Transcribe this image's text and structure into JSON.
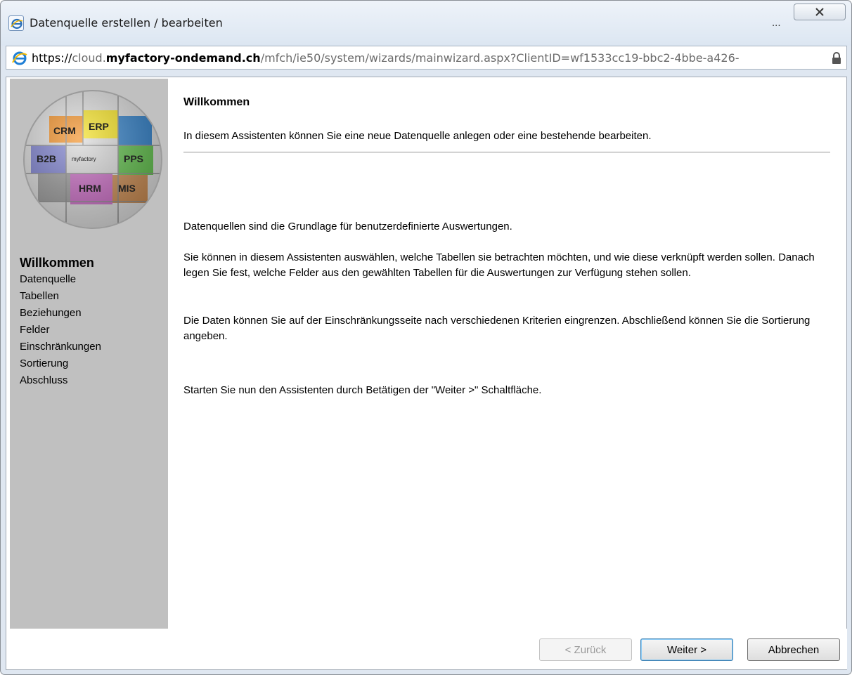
{
  "window": {
    "title": "Datenquelle erstellen / bearbeiten",
    "ellipsis": "..."
  },
  "address": {
    "scheme": "https://",
    "subdomain": "cloud.",
    "domain": "myfactory-ondemand.ch",
    "path": "/mfch/ie50/system/wizards/mainwizard.aspx?ClientID=wf1533cc19-bbc2-4bbe-a426-"
  },
  "logo_labels": [
    "CRM",
    "ERP",
    "B2B",
    "myfactory",
    "PPS",
    "HRM",
    "MIS"
  ],
  "sidebar": {
    "items": [
      {
        "label": "Willkommen",
        "active": true
      },
      {
        "label": "Datenquelle",
        "active": false
      },
      {
        "label": "Tabellen",
        "active": false
      },
      {
        "label": "Beziehungen",
        "active": false
      },
      {
        "label": "Felder",
        "active": false
      },
      {
        "label": "Einschränkungen",
        "active": false
      },
      {
        "label": "Sortierung",
        "active": false
      },
      {
        "label": "Abschluss",
        "active": false
      }
    ]
  },
  "main": {
    "heading": "Willkommen",
    "intro": "In diesem Assistenten können Sie eine neue Datenquelle anlegen oder eine bestehende bearbeiten.",
    "paragraphs": [
      "Datenquellen sind die Grundlage für benutzerdefinierte Auswertungen.",
      "Sie können in diesem Assistenten auswählen, welche Tabellen sie betrachten möchten, und wie diese verknüpft werden sollen. Danach legen Sie fest, welche Felder aus den gewählten Tabellen für die Auswertungen zur Verfügung stehen sollen.",
      "Die Daten können Sie auf der Einschränkungsseite nach verschiedenen Kriterien eingrenzen. Abschließend können Sie die Sortierung angeben.",
      "Starten Sie nun den Assistenten durch Betätigen der \"Weiter >\" Schaltfläche."
    ]
  },
  "buttons": {
    "back": "< Zurück",
    "next": "Weiter >",
    "cancel": "Abbrechen"
  }
}
